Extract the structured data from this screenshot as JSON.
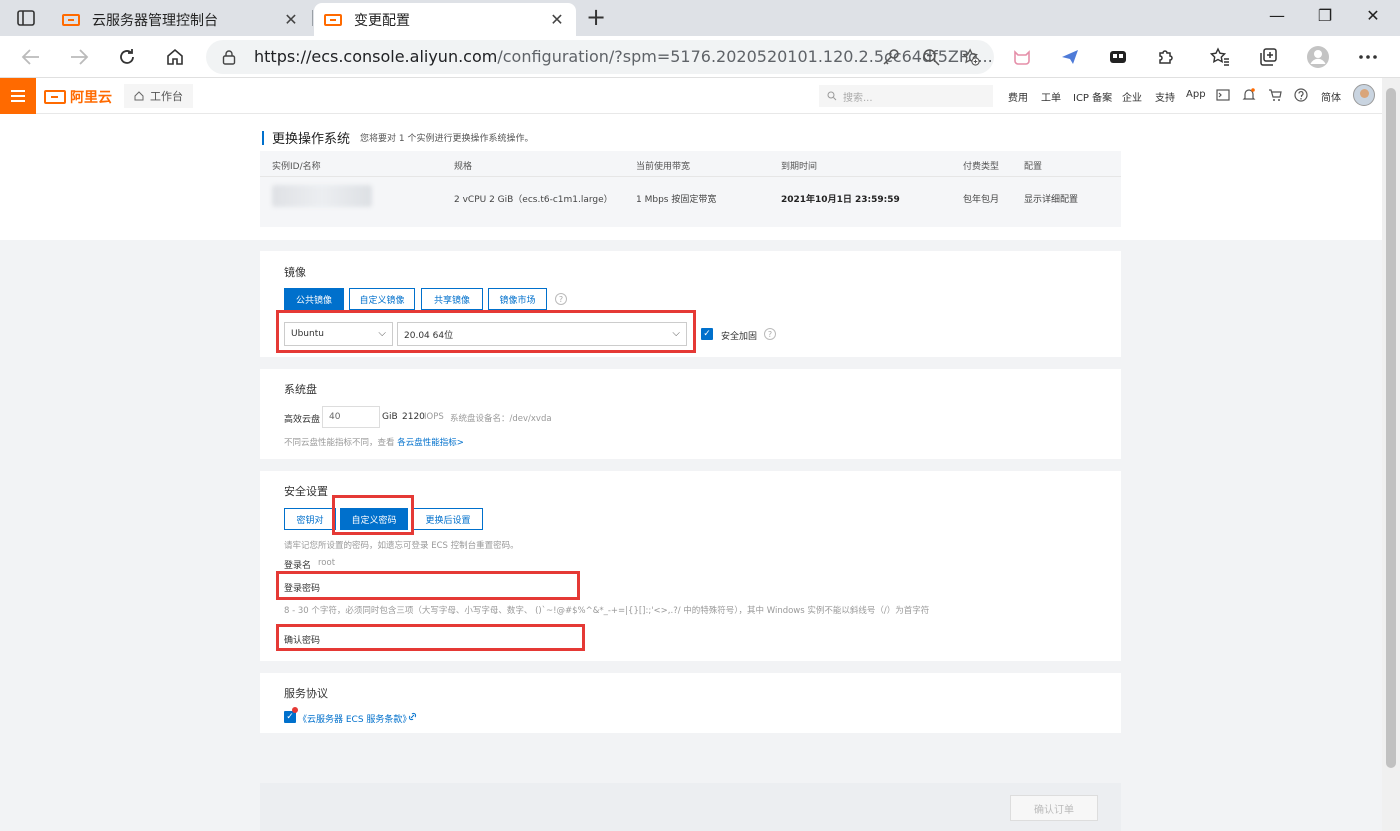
{
  "browser": {
    "tabs": [
      {
        "label": "云服务器管理控制台",
        "close": "✕"
      },
      {
        "label": "变更配置",
        "close": "✕"
      }
    ],
    "new_tab": "+",
    "window": {
      "minimize": "—",
      "restore": "❐",
      "close": "✕"
    },
    "url_host": "https://ecs.console.aliyun.com",
    "url_path": "/configuration/?spm=5176.2020520101.120.2.5cc64df5ZPo..."
  },
  "console_header": {
    "logo_text": "阿里云",
    "workbench": "工作台",
    "search_placeholder": "搜索...",
    "nav": [
      "费用",
      "工单",
      "ICP 备案",
      "企业",
      "支持",
      "App"
    ],
    "lang": "简体"
  },
  "page": {
    "title": "更换操作系统",
    "subtitle": "您将要对 1 个实例进行更换操作系统操作。",
    "table": {
      "headers": [
        "实例ID/名称",
        "规格",
        "当前使用带宽",
        "到期时间",
        "付费类型",
        "配置"
      ],
      "row": {
        "spec": "2 vCPU 2 GiB（ecs.t6-c1m1.large）",
        "bandwidth": "1 Mbps 按固定带宽",
        "expire": "2021年10月1日 23:59:59",
        "pay_type": "包年包月",
        "config_link": "显示详细配置"
      }
    }
  },
  "image_section": {
    "title": "镜像",
    "tabs": [
      "公共镜像",
      "自定义镜像",
      "共享镜像",
      "镜像市场"
    ],
    "os": "Ubuntu",
    "version": "20.04 64位",
    "security_label": "安全加固"
  },
  "disk_section": {
    "title": "系统盘",
    "type": "高效云盘",
    "size": "40",
    "unit": "GiB",
    "iops_value": "2120",
    "iops_label": "IOPS",
    "device_label": "系统盘设备名：/dev/xvda",
    "hint_prefix": "不同云盘性能指标不同，查看 ",
    "hint_link": "各云盘性能指标>"
  },
  "security_section": {
    "title": "安全设置",
    "tabs": [
      "密钥对",
      "自定义密码",
      "更换后设置"
    ],
    "note": "请牢记您所设置的密码，如遗忘可登录 ECS 控制台重置密码。",
    "login_name_label": "登录名",
    "login_name_value": "root",
    "password_label": "登录密码",
    "password_rule": "8 - 30 个字符，必须同时包含三项（大写字母、小写字母、数字、 ()`~!@#$%^&*_-+=|{}[]:;'<>,.?/ 中的特殊符号），其中 Windows 实例不能以斜线号（/）为首字符",
    "confirm_label": "确认密码"
  },
  "agreement_section": {
    "title": "服务协议",
    "link": "《云服务器 ECS 服务条款》"
  },
  "footer": {
    "confirm_button": "确认订单"
  },
  "colors": {
    "brand": "#ff6a00",
    "primary": "#0070cc",
    "highlight": "#e53935"
  }
}
